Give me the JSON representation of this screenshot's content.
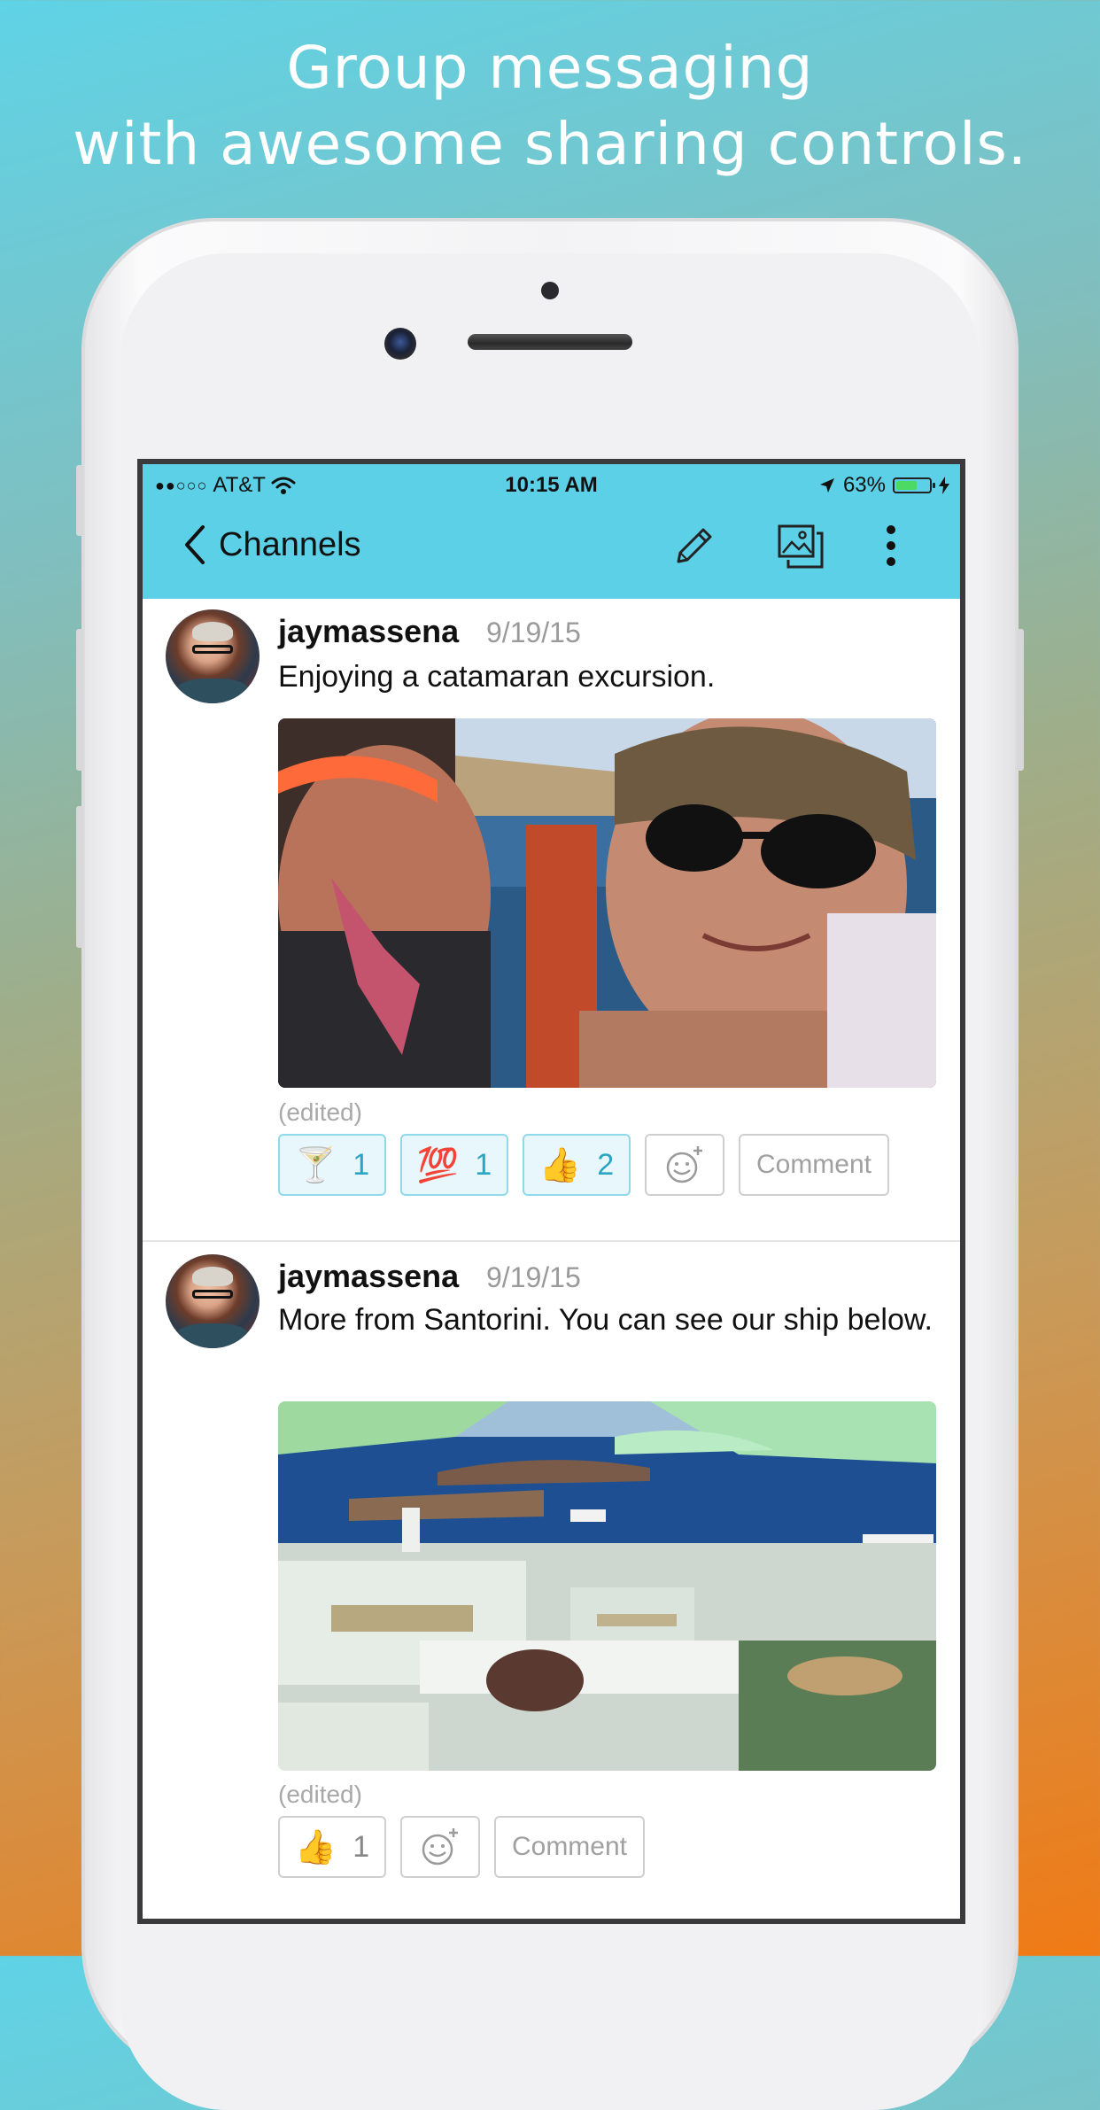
{
  "headline": {
    "line1": "Group messaging",
    "line2": "with awesome sharing controls."
  },
  "status_bar": {
    "signal": "●●○○○",
    "carrier": "AT&T",
    "time": "10:15 AM",
    "battery_percent": "63%",
    "battery_level": 0.63
  },
  "nav": {
    "back_label": "Channels",
    "icons": [
      "edit-pencil-icon",
      "photo-gallery-icon",
      "more-vertical-icon"
    ]
  },
  "posts": [
    {
      "username": "jaymassena",
      "date": "9/19/15",
      "message": "Enjoying a catamaran excursion.",
      "edited": "(edited)",
      "reactions": [
        {
          "emoji": "🍸",
          "count": "1"
        },
        {
          "emoji": "💯",
          "count": "1"
        },
        {
          "emoji": "👍",
          "count": "2"
        }
      ],
      "comment_label": "Comment"
    },
    {
      "username": "jaymassena",
      "date": "9/19/15",
      "message": "More from Santorini. You can see our ship below.",
      "edited": "(edited)",
      "reactions": [
        {
          "emoji": "👍",
          "count": "1"
        }
      ],
      "comment_label": "Comment"
    }
  ],
  "colors": {
    "nav_bar": "#5bd0e6",
    "reaction_active_border": "#8fd9ea",
    "reaction_active_text": "#28a6c4",
    "battery_fill": "#4cd964"
  }
}
